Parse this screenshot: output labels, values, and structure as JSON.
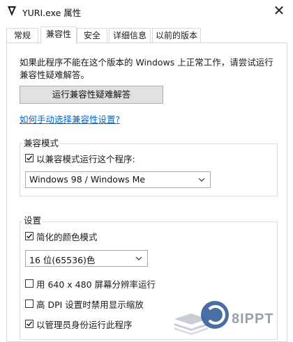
{
  "window": {
    "title": "YURI.exe 属性",
    "close_glyph": "✕"
  },
  "tabs": [
    {
      "label": "常规"
    },
    {
      "label": "兼容性"
    },
    {
      "label": "安全"
    },
    {
      "label": "详细信息"
    },
    {
      "label": "以前的版本"
    }
  ],
  "active_tab": "兼容性",
  "compat": {
    "intro": "如果此程序不能在这个版本的 Windows 上正常工作，请尝试运行兼容性疑难解答。",
    "run_troubleshooter_button": "运行兼容性疑难解答",
    "manual_link": "如何手动选择兼容性设置?"
  },
  "compat_mode": {
    "group_label": "兼容模式",
    "checkbox_label": "以兼容模式运行这个程序:",
    "checked": true,
    "selected_os": "Windows 98 / Windows Me"
  },
  "settings": {
    "group_label": "设置",
    "reduced_color": {
      "label": "简化的颜色模式",
      "checked": true
    },
    "color_depth": "16 位(65536)色",
    "res_640": {
      "label": "用 640 x 480 屏幕分辨率运行",
      "checked": false
    },
    "dpi_scaling": {
      "label": "高 DPI 设置时禁用显示缩放",
      "checked": false
    },
    "run_as_admin": {
      "label": "以管理员身份运行此程序",
      "checked": true
    }
  },
  "watermark": {
    "text": "8IPPT",
    "icon": "layers-icon"
  },
  "colors": {
    "link": "#0066cc",
    "button_bg": "#e1e1e1",
    "border": "#d9d9d9"
  }
}
